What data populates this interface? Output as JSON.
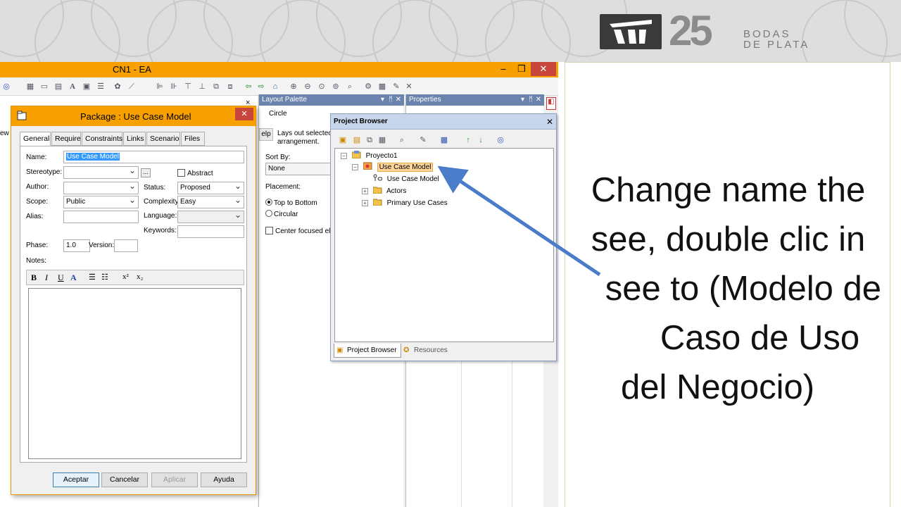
{
  "banner": {
    "logo_number": "25",
    "logo_line1": "BODAS",
    "logo_line2": "DE PLATA"
  },
  "ea": {
    "title": "CN1 - EA",
    "minimize": "–",
    "maximize": "❐",
    "close": "✕",
    "diagram_close": "×",
    "left_strip": "ew",
    "layout_palette": {
      "title": "Layout Palette",
      "circle": "Circle",
      "help": "elp",
      "description_line1": "Lays out selectec",
      "description_line2": "arrangement.",
      "sort_by_label": "Sort By:",
      "sort_by_value": "None",
      "placement_label": "Placement:",
      "option_top_to_bottom": "Top to Bottom",
      "option_circular": "Circular",
      "center_focused": "Center focused ele"
    },
    "properties": {
      "title": "Properties"
    }
  },
  "project_browser": {
    "title": "Project Browser",
    "close": "✕",
    "tree": [
      {
        "label": "Proyecto1",
        "expander": "⊟"
      },
      {
        "label": "Use Case Model",
        "expander": "⊟",
        "selected": true
      },
      {
        "label": "Use Case Model",
        "expander": ""
      },
      {
        "label": "Actors",
        "expander": "⊞"
      },
      {
        "label": "Primary Use Cases",
        "expander": "⊞"
      }
    ],
    "tab_browser": "Project Browser",
    "tab_resources": "Resources"
  },
  "package_dialog": {
    "title": "Package : Use Case Model",
    "close": "✕",
    "tabs": [
      "General",
      "Require",
      "Constraints",
      "Links",
      "Scenario",
      "Files"
    ],
    "name_label": "Name:",
    "name_value": "Use Case Model",
    "stereotype_label": "Stereotype:",
    "stereotype_value": "",
    "ellipsis": "...",
    "abstract_label": "Abstract",
    "author_label": "Author:",
    "author_value": "",
    "status_label": "Status:",
    "status_value": "Proposed",
    "scope_label": "Scope:",
    "scope_value": "Public",
    "complexity_label": "Complexity:",
    "complexity_value": "Easy",
    "alias_label": "Alias:",
    "language_label": "Language:",
    "language_value": "",
    "keywords_label": "Keywords:",
    "phase_label": "Phase:",
    "phase_value": "1.0",
    "version_label": "Version:",
    "version_value": "",
    "notes_label": "Notes:",
    "fmt_bold": "B",
    "fmt_italic": "I",
    "fmt_underline": "U",
    "fmt_color": "A",
    "fmt_bullets": "☰",
    "fmt_numbers": "☷",
    "fmt_super": "x²",
    "fmt_sub": "x₂",
    "btn_accept": "Aceptar",
    "btn_cancel": "Cancelar",
    "btn_apply": "Aplicar",
    "btn_help": "Ayuda"
  },
  "instruction": {
    "line1": "Change name the",
    "line2": "see, double clic in",
    "line3": "see to (Modelo de",
    "line4": "Caso de Uso",
    "line5": "del Negocio)"
  },
  "colors": {
    "title_orange": "#f7a000",
    "close_red": "#c9463d",
    "arrow_blue": "#4a7cc9",
    "selection_blue": "#3399ff"
  }
}
